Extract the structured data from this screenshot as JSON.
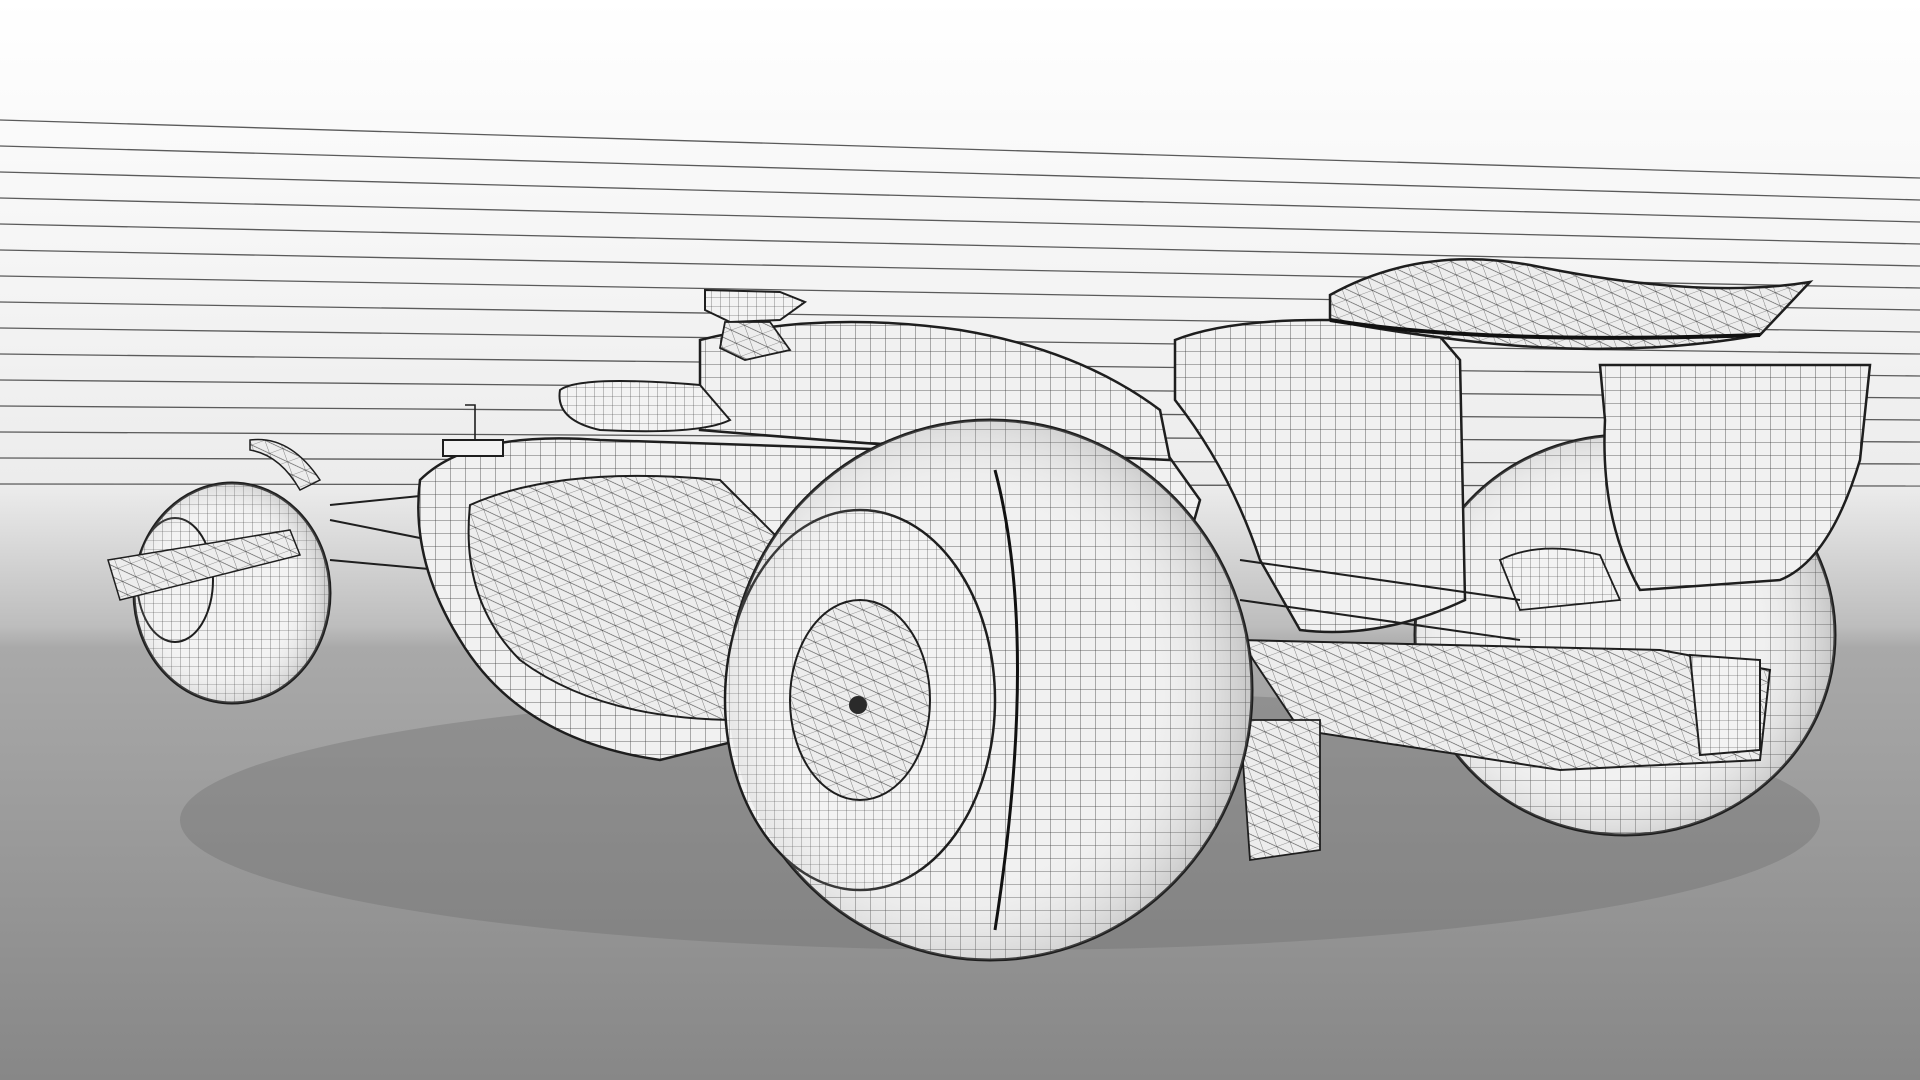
{
  "scene": {
    "subject": "formula-car-wireframe",
    "view": "rear-three-quarter",
    "colors": {
      "backdrop_top": "#f7f7f7",
      "backdrop_bottom": "#b8b8b8",
      "floor": "#8c8c8c",
      "floor_dark": "#7a7a7a",
      "surface": "#eeeeee",
      "wire": "#1e1e1e",
      "stripe": "#555555"
    }
  }
}
